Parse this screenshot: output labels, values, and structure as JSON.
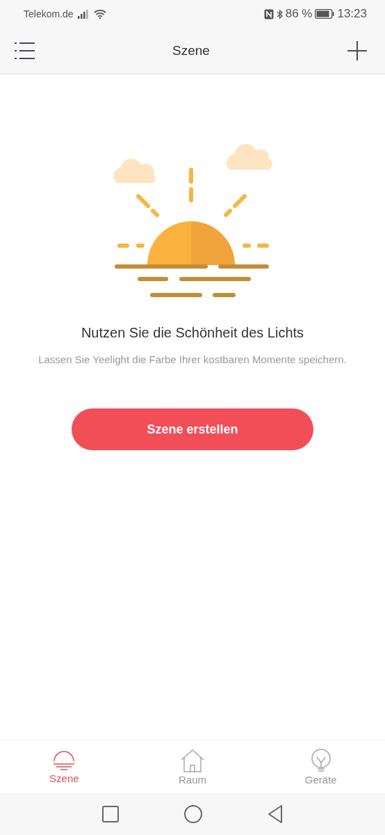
{
  "status_bar": {
    "carrier": "Telekom.de",
    "battery_text": "86 %",
    "time": "13:23"
  },
  "header": {
    "title": "Szene"
  },
  "empty_state": {
    "title": "Nutzen Sie die Schönheit des Lichts",
    "message": "Lassen Sie Yeelight die Farbe Ihrer kostbaren Momente speichern.",
    "button": "Szene erstellen"
  },
  "tabs": [
    {
      "label": "Szene",
      "kind": "scene",
      "selected": true
    },
    {
      "label": "Raum",
      "kind": "room",
      "selected": false
    },
    {
      "label": "Geräte",
      "kind": "device",
      "selected": false
    }
  ]
}
